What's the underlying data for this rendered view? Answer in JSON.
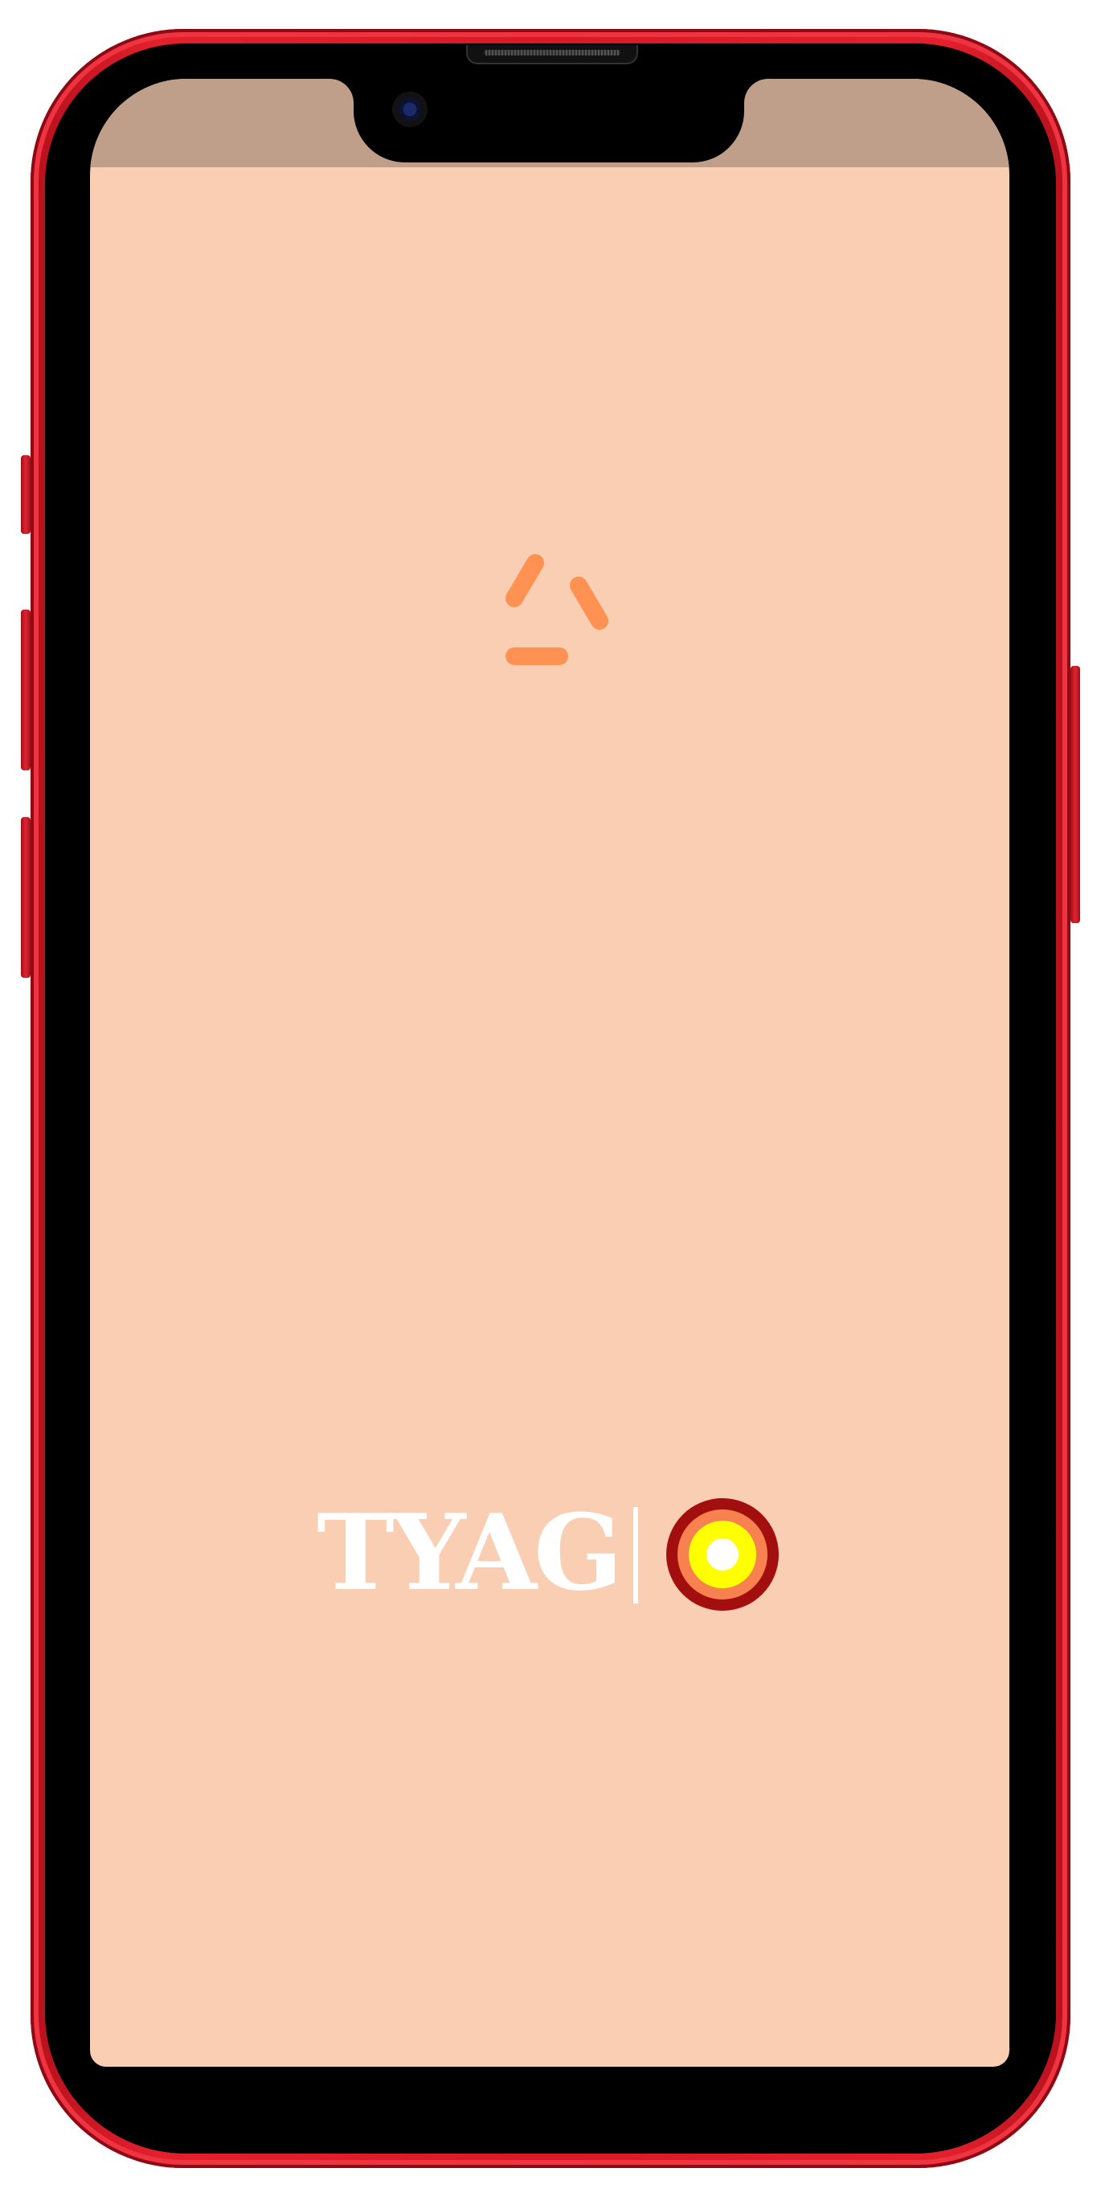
{
  "app": {
    "brand_name": "TYAG"
  },
  "colors": {
    "screen_background": "#f9ceb2",
    "status_bar": "#bf9f8a",
    "spinner": "#ff9253",
    "phone_body": "#d71a26",
    "logo_ring_outer": "#a30f0f",
    "logo_ring_middle": "#f7814f",
    "logo_ring_inner": "#ffff00",
    "logo_center": "#ffffff"
  },
  "icons": {
    "spinner": "loading-spinner-icon",
    "brand_mark": "target-ring-logo-icon"
  }
}
